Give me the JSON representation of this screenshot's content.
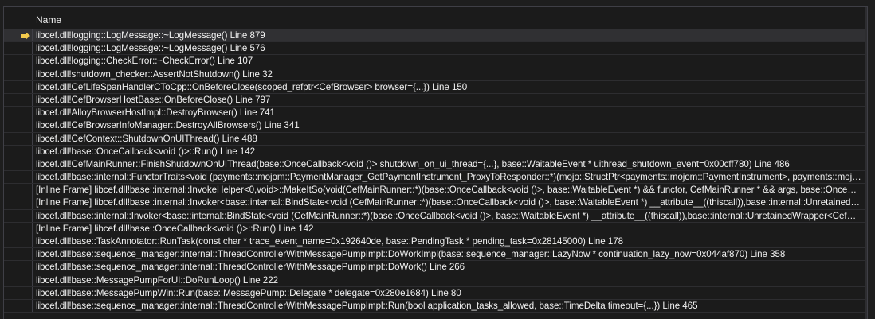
{
  "header": {
    "name_label": "Name"
  },
  "frames": [
    "libcef.dll!logging::LogMessage::~LogMessage() Line 879",
    "libcef.dll!logging::LogMessage::~LogMessage() Line 576",
    "libcef.dll!logging::CheckError::~CheckError() Line 107",
    "libcef.dll!shutdown_checker::AssertNotShutdown() Line 32",
    "libcef.dll!CefLifeSpanHandlerCToCpp::OnBeforeClose(scoped_refptr<CefBrowser> browser={...}) Line 150",
    "libcef.dll!CefBrowserHostBase::OnBeforeClose() Line 797",
    "libcef.dll!AlloyBrowserHostImpl::DestroyBrowser() Line 741",
    "libcef.dll!CefBrowserInfoManager::DestroyAllBrowsers() Line 341",
    "libcef.dll!CefContext::ShutdownOnUIThread() Line 488",
    "libcef.dll!base::OnceCallback<void ()>::Run() Line 142",
    "libcef.dll!CefMainRunner::FinishShutdownOnUIThread(base::OnceCallback<void ()> shutdown_on_ui_thread={...}, base::WaitableEvent * uithread_shutdown_event=0x00cff780) Line 486",
    "libcef.dll!base::internal::FunctorTraits<void (payments::mojom::PaymentManager_GetPaymentInstrument_ProxyToResponder::*)(mojo::StructPtr<payments::mojom::PaymentInstrument>, payments::mojo...",
    "[Inline Frame] libcef.dll!base::internal::InvokeHelper<0,void>::MakeItSo(void(CefMainRunner::*)(base::OnceCallback<void ()>, base::WaitableEvent *) && functor, CefMainRunner * && args, base::OnceCall...",
    "[Inline Frame] libcef.dll!base::internal::Invoker<base::internal::BindState<void (CefMainRunner::*)(base::OnceCallback<void ()>, base::WaitableEvent *) __attribute__((thiscall)),base::internal::UnretainedWrap...",
    "libcef.dll!base::internal::Invoker<base::internal::BindState<void (CefMainRunner::*)(base::OnceCallback<void ()>, base::WaitableEvent *) __attribute__((thiscall)),base::internal::UnretainedWrapper<CefMainR...",
    "[Inline Frame] libcef.dll!base::OnceCallback<void ()>::Run() Line 142",
    "libcef.dll!base::TaskAnnotator::RunTask(const char * trace_event_name=0x192640de, base::PendingTask * pending_task=0x28145000) Line 178",
    "libcef.dll!base::sequence_manager::internal::ThreadControllerWithMessagePumpImpl::DoWorkImpl(base::sequence_manager::LazyNow * continuation_lazy_now=0x044af870) Line 358",
    "libcef.dll!base::sequence_manager::internal::ThreadControllerWithMessagePumpImpl::DoWork() Line 266",
    "libcef.dll!base::MessagePumpForUI::DoRunLoop() Line 222",
    "libcef.dll!base::MessagePumpWin::Run(base::MessagePump::Delegate * delegate=0x280e1684) Line 80",
    "libcef.dll!base::sequence_manager::internal::ThreadControllerWithMessagePumpImpl::Run(bool application_tasks_allowed, base::TimeDelta timeout={...}) Line 465"
  ],
  "current_frame_index": 0,
  "colors": {
    "current_arrow": "#f2c94c",
    "background": "#1b1b1b",
    "text": "#f1f1f1"
  },
  "icons": {
    "current_frame": "current-frame-arrow-icon"
  }
}
